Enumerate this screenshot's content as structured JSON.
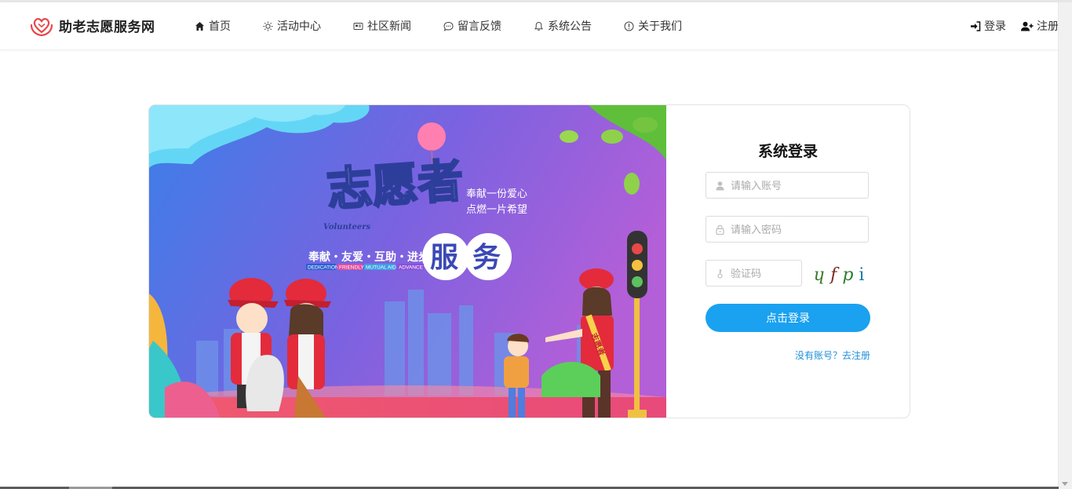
{
  "brand": {
    "name": "助老志愿服务网",
    "logo_icon": "heart-hands-icon",
    "accent": "#e8464a"
  },
  "nav": [
    {
      "label": "首页",
      "icon": "home-icon"
    },
    {
      "label": "活动中心",
      "icon": "sun-icon"
    },
    {
      "label": "社区新闻",
      "icon": "news-icon"
    },
    {
      "label": "留言反馈",
      "icon": "chat-icon"
    },
    {
      "label": "系统公告",
      "icon": "bell-icon"
    },
    {
      "label": "关于我们",
      "icon": "info-icon"
    }
  ],
  "user_links": {
    "login": "登录",
    "register": "注册"
  },
  "banner": {
    "title_main": "志愿者",
    "title_sub": "服务",
    "english": "Volunteers",
    "slogan_line1": "奉献一份爱心",
    "slogan_line2": "点燃一片希望",
    "values_cn": "奉献・友爱・互助・进步",
    "values_en": [
      "DEDICATION",
      "FRIENDLY",
      "MUTUAL AID",
      "ADVANCE"
    ],
    "sash_text": "志愿者"
  },
  "login_form": {
    "title": "系统登录",
    "username_placeholder": "请输入账号",
    "password_placeholder": "请输入密码",
    "captcha_placeholder": "验证码",
    "captcha_chars": [
      {
        "ch": "ɥ",
        "color": "#3d7a2b"
      },
      {
        "ch": "f",
        "color": "#7a2b1a"
      },
      {
        "ch": "p",
        "color": "#2f7a2f"
      },
      {
        "ch": "i",
        "color": "#1a78a8"
      }
    ],
    "submit_label": "点击登录",
    "register_link": "没有账号？去注册",
    "button_color": "#1aa1f0"
  }
}
